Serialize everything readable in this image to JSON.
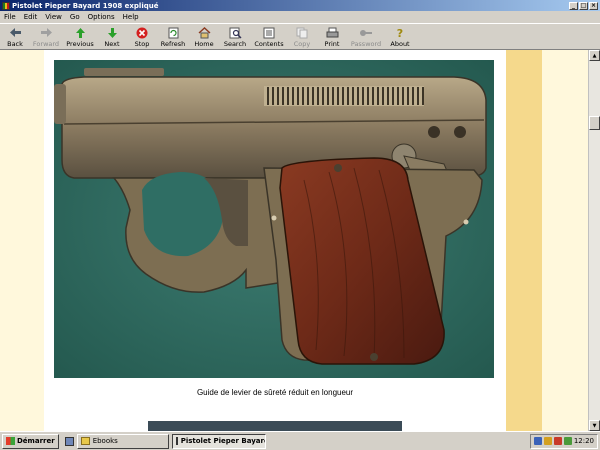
{
  "window": {
    "title": "Pistolet Pieper Bayard 1908 expliqué"
  },
  "menu": [
    "File",
    "Edit",
    "View",
    "Go",
    "Options",
    "Help"
  ],
  "toolbar": [
    {
      "label": "Back",
      "icon": "back-arrow-icon",
      "enabled": true
    },
    {
      "label": "Forward",
      "icon": "forward-arrow-icon",
      "enabled": false
    },
    {
      "label": "Previous",
      "icon": "up-arrow-icon",
      "enabled": true
    },
    {
      "label": "Next",
      "icon": "down-arrow-icon",
      "enabled": true
    },
    {
      "label": "Stop",
      "icon": "stop-icon",
      "enabled": true
    },
    {
      "label": "Refresh",
      "icon": "refresh-icon",
      "enabled": true
    },
    {
      "label": "Home",
      "icon": "home-icon",
      "enabled": true
    },
    {
      "label": "Search",
      "icon": "search-icon",
      "enabled": true
    },
    {
      "label": "Contents",
      "icon": "contents-icon",
      "enabled": true
    },
    {
      "label": "Copy",
      "icon": "copy-icon",
      "enabled": false
    },
    {
      "label": "Print",
      "icon": "print-icon",
      "enabled": true
    },
    {
      "label": "Password",
      "icon": "password-key-icon",
      "enabled": false
    },
    {
      "label": "About",
      "icon": "about-icon",
      "enabled": true
    }
  ],
  "content": {
    "caption": "Guide de levier de sûreté réduit en longueur",
    "photo_subject": "pistol-photo"
  },
  "taskbar": {
    "start_label": "Démarrer",
    "tasks": [
      {
        "label": "Ebooks",
        "icon": "folder-icon",
        "active": false
      },
      {
        "label": "Pistolet Pieper Bayard...",
        "icon": "ebook-icon",
        "active": true
      }
    ],
    "clock": "12:20"
  },
  "colors": {
    "page_bg": "#fff8dc",
    "stripe": "#f5d98c",
    "felt": "#2f6e64",
    "title_start": "#0a246a",
    "title_end": "#a6caf0"
  }
}
